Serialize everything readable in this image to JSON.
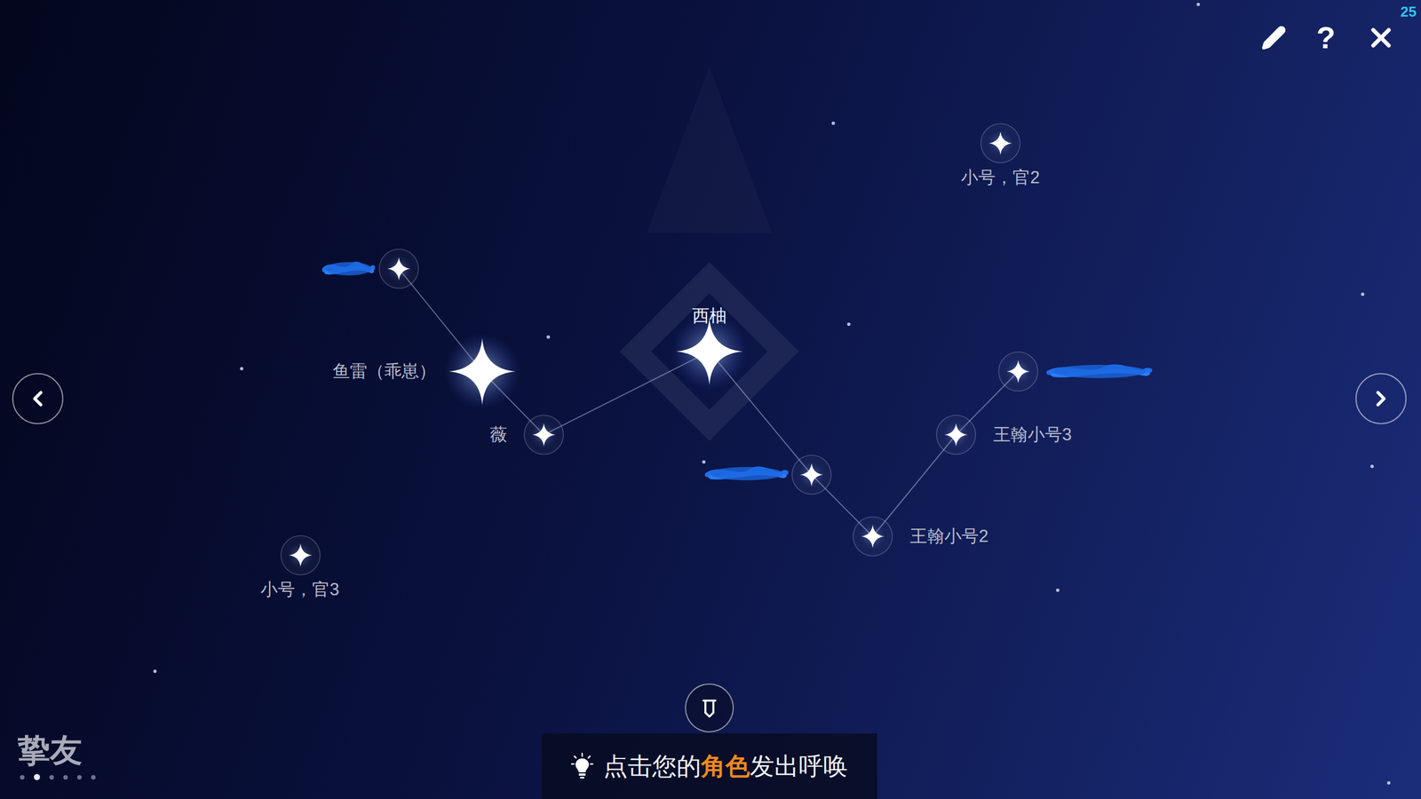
{
  "status": {
    "counter": "25"
  },
  "toolbar": {
    "help": "?"
  },
  "page": {
    "title": "挚友",
    "dots": [
      {
        "selected": false
      },
      {
        "selected": true
      },
      {
        "selected": false
      },
      {
        "selected": false
      },
      {
        "selected": false
      },
      {
        "selected": false
      }
    ]
  },
  "friends": [
    {
      "redacted": true,
      "bright": false
    },
    {
      "label": "鱼雷（乖崽）",
      "redacted": false,
      "bright": true
    },
    {
      "label": "薇",
      "redacted": false,
      "bright": false
    },
    {
      "label": "西柚",
      "redacted": false,
      "bright": true
    },
    {
      "redacted": true,
      "bright": false
    },
    {
      "label": "王翰小号2",
      "redacted": false,
      "bright": false
    },
    {
      "label": "王翰小号3",
      "redacted": false,
      "bright": false
    },
    {
      "redacted": true,
      "bright": false
    },
    {
      "label": "小号，官2",
      "redacted": false,
      "bright": false
    },
    {
      "label": "小号，官3",
      "redacted": false,
      "bright": false
    }
  ],
  "links": [
    [
      0,
      1
    ],
    [
      1,
      2
    ],
    [
      2,
      3
    ],
    [
      3,
      4
    ],
    [
      4,
      5
    ],
    [
      5,
      6
    ],
    [
      6,
      7
    ]
  ],
  "hint": {
    "parts": [
      {
        "text": "点击您的",
        "highlight": false
      },
      {
        "text": "角色",
        "highlight": true
      },
      {
        "text": "发出呼唤",
        "highlight": false
      }
    ]
  }
}
